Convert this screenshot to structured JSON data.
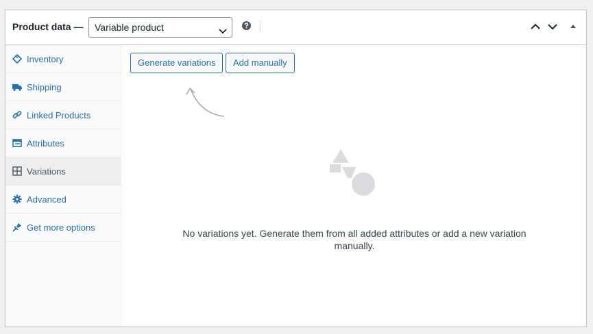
{
  "header": {
    "title": "Product data —",
    "product_type": "Variable product",
    "icons": {
      "help": "help-icon",
      "type_chevron": "chevron-down-icon",
      "move_up": "chevron-up-icon",
      "move_down": "chevron-down-icon",
      "toggle": "triangle-up-icon"
    }
  },
  "sidebar": {
    "items": [
      {
        "label": "Inventory",
        "icon": "tag-icon"
      },
      {
        "label": "Shipping",
        "icon": "truck-icon"
      },
      {
        "label": "Linked Products",
        "icon": "link-icon"
      },
      {
        "label": "Attributes",
        "icon": "list-icon"
      },
      {
        "label": "Variations",
        "icon": "grid-icon",
        "active": true
      },
      {
        "label": "Advanced",
        "icon": "gear-icon"
      },
      {
        "label": "Get more options",
        "icon": "plugin-icon"
      }
    ]
  },
  "main": {
    "generate_label": "Generate variations",
    "add_manually_label": "Add manually",
    "empty_message": "No variations yet. Generate them from all added attributes or add a new variation manually.",
    "illustration": "shapes-illustration-icon",
    "hint_arrow": "curved-arrow-icon"
  },
  "colors": {
    "accent": "#2271b1",
    "border": "#c3c4c7",
    "active_tab_bg": "#eeeeee"
  }
}
